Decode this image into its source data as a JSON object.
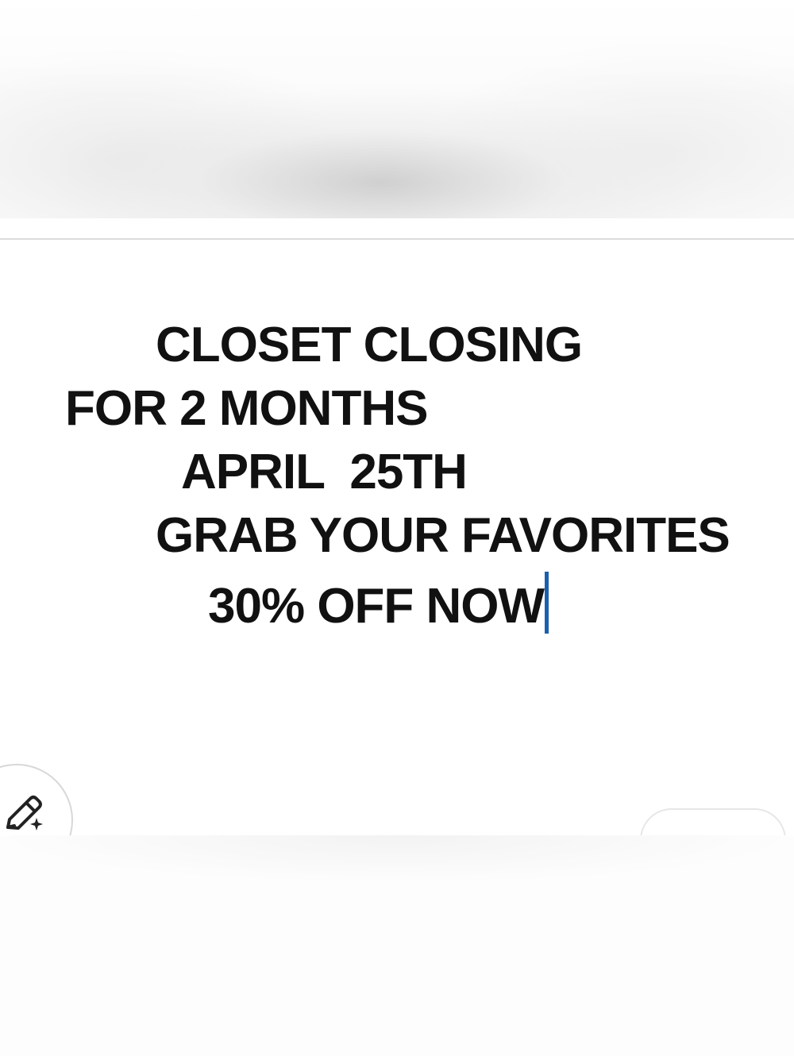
{
  "note": {
    "lines": [
      "CLOSET CLOSING",
      "FOR 2 MONTHS",
      "APRIL  25TH",
      "GRAB YOUR FAVORITES",
      "30% OFF NOW"
    ]
  },
  "icons": {
    "edit": "pencil-sparkle-icon"
  },
  "colors": {
    "text": "#111111",
    "caret": "#1a5fb0",
    "background": "#ffffff",
    "divider": "#dcdcdc"
  }
}
